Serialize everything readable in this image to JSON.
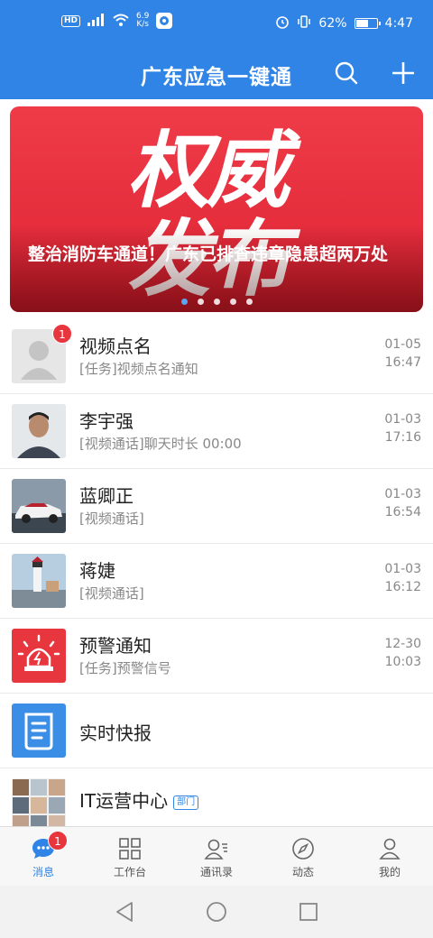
{
  "status_bar": {
    "network_chip": "HD",
    "speed_value": "6.9",
    "speed_unit": "K/s",
    "battery_percent": "62%",
    "battery_level": 0.62,
    "clock": "4:47"
  },
  "header": {
    "title": "广东应急一键通"
  },
  "banner": {
    "art_text": "权威发布",
    "caption": "整治消防车通道！广东已排查违章隐患超两万处",
    "slides": 5,
    "active_slide": 0
  },
  "conversations": [
    {
      "name": "视频点名",
      "subtitle": "[任务]视频点名通知",
      "date": "01-05",
      "time": "16:47",
      "badge": "1",
      "avatar": "placeholder"
    },
    {
      "name": "李宇强",
      "subtitle": "[视频通话]聊天时长 00:00",
      "date": "01-03",
      "time": "17:16",
      "avatar": "person-photo"
    },
    {
      "name": "蓝卿正",
      "subtitle": "[视频通话]",
      "date": "01-03",
      "time": "16:54",
      "avatar": "car-photo"
    },
    {
      "name": "蒋婕",
      "subtitle": "[视频通话]",
      "date": "01-03",
      "time": "16:12",
      "avatar": "lighthouse-photo"
    },
    {
      "name": "预警通知",
      "subtitle": "[任务]预警信号",
      "date": "12-30",
      "time": "10:03",
      "avatar": "alarm-icon",
      "color": "#e8363e"
    },
    {
      "name": "实时快报",
      "subtitle": "",
      "date": "",
      "time": "",
      "avatar": "news-icon",
      "color": "#3a8ee6"
    },
    {
      "name": "IT运营中心",
      "tag": "部门",
      "subtitle": "",
      "date": "",
      "time": "",
      "avatar": "group-photo-grid"
    }
  ],
  "tabbar": {
    "items": [
      {
        "label": "消息",
        "icon": "chat-bubble-icon",
        "active": true,
        "badge": "1"
      },
      {
        "label": "工作台",
        "icon": "grid-icon"
      },
      {
        "label": "通讯录",
        "icon": "contacts-icon"
      },
      {
        "label": "动态",
        "icon": "compass-icon"
      },
      {
        "label": "我的",
        "icon": "person-icon"
      }
    ]
  },
  "colors": {
    "primary": "#2f84e6",
    "badge": "#e8363e",
    "banner": "#e52d3c"
  }
}
